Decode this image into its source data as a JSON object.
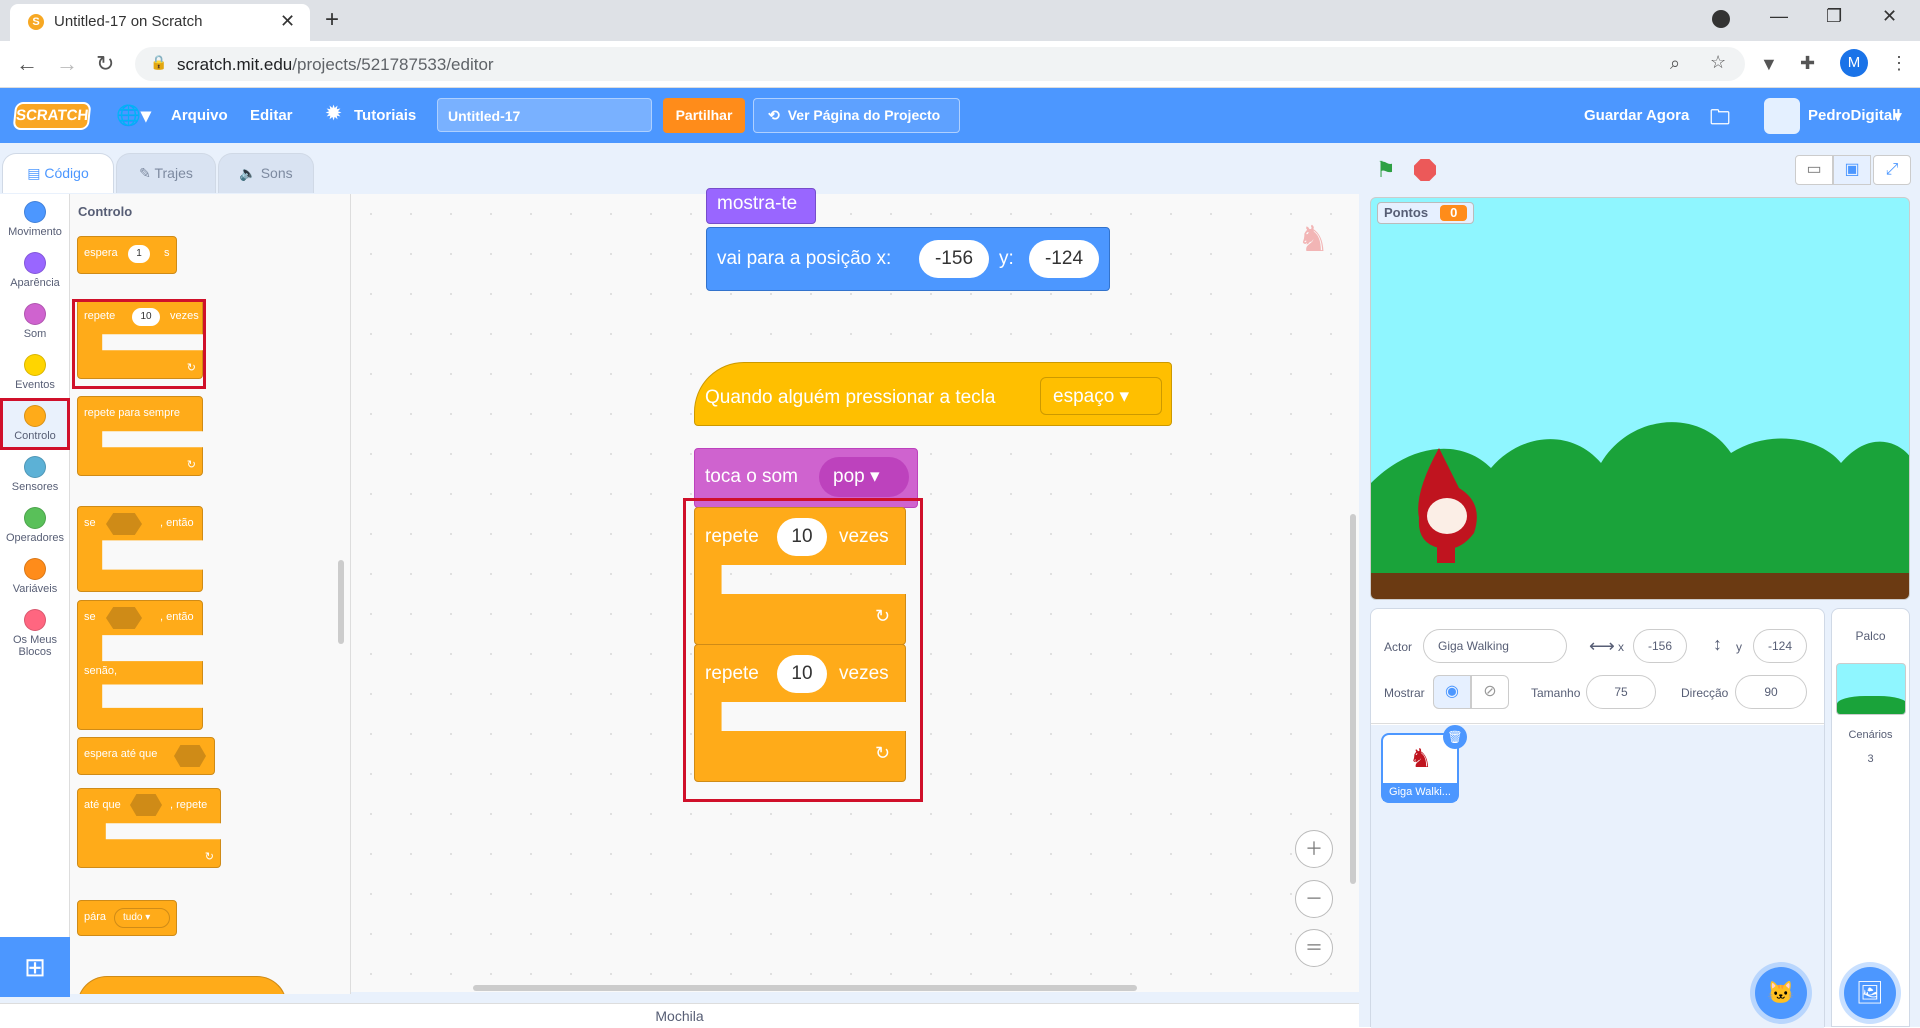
{
  "browser": {
    "tab_title": "Untitled-17 on Scratch",
    "url_host": "scratch.mit.edu",
    "url_path": "/projects/521787533/editor",
    "profile_initial": "M"
  },
  "menu": {
    "logo": "SCRATCH",
    "file": "Arquivo",
    "edit": "Editar",
    "tutorials": "Tutoriais",
    "project_title": "Untitled-17",
    "share": "Partilhar",
    "see_project": "Ver Página do Projecto",
    "save_now": "Guardar Agora",
    "username": "PedroDigitall"
  },
  "editor_tabs": {
    "code": "Código",
    "costumes": "Trajes",
    "sounds": "Sons"
  },
  "categories": [
    {
      "label": "Movimento",
      "color": "#4c97ff"
    },
    {
      "label": "Aparência",
      "color": "#9966ff"
    },
    {
      "label": "Som",
      "color": "#cf63cf"
    },
    {
      "label": "Eventos",
      "color": "#ffd500"
    },
    {
      "label": "Controlo",
      "color": "#ffab19"
    },
    {
      "label": "Sensores",
      "color": "#5cb1d6"
    },
    {
      "label": "Operadores",
      "color": "#59c059"
    },
    {
      "label": "Variáveis",
      "color": "#ff8c1a"
    },
    {
      "label": "Os Meus Blocos",
      "color": "#ff6680"
    }
  ],
  "palette": {
    "heading": "Controlo",
    "wait": {
      "label": "espera",
      "value": "1",
      "unit": "s"
    },
    "repeat": {
      "label": "repete",
      "value": "10",
      "suffix": "vezes"
    },
    "forever": "repete para sempre",
    "if_then": {
      "pre": "se",
      "post": ", então"
    },
    "if_else": {
      "pre": "se",
      "post": ", então",
      "else": "senão,"
    },
    "wait_until": "espera até que",
    "repeat_until": {
      "pre": "até que",
      "post": ", repete"
    },
    "stop": {
      "label": "pára",
      "option": "tudo"
    }
  },
  "script": {
    "show": "mostra-te",
    "goto": {
      "label": "vai para a posição x:",
      "x": "-156",
      "ylabel": "y:",
      "y": "-124"
    },
    "hat": {
      "label": "Quando alguém pressionar a tecla",
      "key": "espaço"
    },
    "sound": {
      "label": "toca o som",
      "sound": "pop"
    },
    "repeat1": {
      "label": "repete",
      "value": "10",
      "suffix": "vezes"
    },
    "repeat2": {
      "label": "repete",
      "value": "10",
      "suffix": "vezes"
    }
  },
  "mochila": "Mochila",
  "stage": {
    "score_label": "Pontos",
    "score_value": "0"
  },
  "sprite_info": {
    "actor_label": "Actor",
    "actor_name": "Giga Walking",
    "x_label": "x",
    "x": "-156",
    "y_label": "y",
    "y": "-124",
    "show_label": "Mostrar",
    "size_label": "Tamanho",
    "size": "75",
    "direction_label": "Direcção",
    "direction": "90"
  },
  "sprites": [
    {
      "name": "Giga Walki..."
    }
  ],
  "stage_panel": {
    "title": "Palco",
    "backdrops_label": "Cenários",
    "backdrops_count": "3"
  }
}
